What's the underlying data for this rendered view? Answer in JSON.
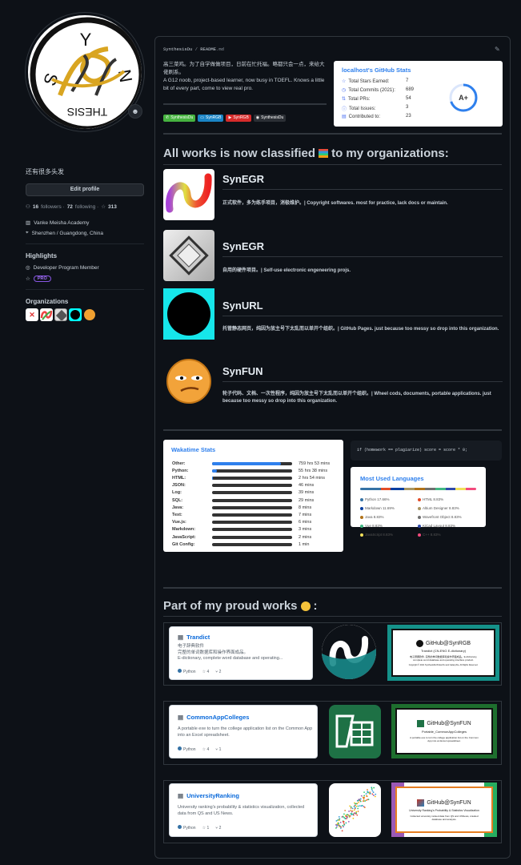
{
  "profile": {
    "bio": "还有很多头发",
    "edit_profile": "Edit profile",
    "followers_count": "16",
    "followers_label": "followers ·",
    "following_count": "72",
    "following_label": "following ·",
    "stars_count": "313",
    "organization": "Vanke Meisha Academy",
    "location": "Shenzhen / Guangdong, China",
    "avatar_letters": [
      "Y",
      "S",
      "N",
      "THESIS"
    ]
  },
  "highlights": {
    "title": "Highlights",
    "program": "Developer Program Member",
    "pro": "PRO"
  },
  "organizations": {
    "title": "Organizations"
  },
  "readme": {
    "user": "SynthesisDu",
    "sep": " / ",
    "file": "README",
    "ext": ".md",
    "intro_cn": "高三菜鸡。为了自学做做项目，日前在忙托福。略都只会一点，来给大佬刷系。",
    "intro_en": "A G12 noob, project-based learner, now busy in TOEFL. Knows a little bit of every part, come to view real pro.",
    "badges": [
      {
        "label": "SynthesisDu",
        "color": "#46b340"
      },
      {
        "label": "SynRGB",
        "color": "#1a84c5"
      },
      {
        "label": "SynRGB",
        "color": "#d62b2b"
      },
      {
        "label": "SynthesisDu",
        "color": "#2b2f35"
      }
    ]
  },
  "gh_stats": {
    "title": "localhost's GitHub Stats",
    "rows": [
      {
        "label": "Total Stars Earned:",
        "value": "7",
        "icon": "☆"
      },
      {
        "label": "Total Commits (2021):",
        "value": "689",
        "icon": "◷"
      },
      {
        "label": "Total PRs:",
        "value": "54",
        "icon": "⇅"
      },
      {
        "label": "Total Issues:",
        "value": "3",
        "icon": "ⓘ"
      },
      {
        "label": "Contributed to:",
        "value": "23",
        "icon": "▤"
      }
    ],
    "grade": "A+",
    "grade_progress": 0.7
  },
  "works_heading": "All works is now classified",
  "works_heading_suffix": "to my organizations:",
  "orgs": [
    {
      "name": "SynEGR",
      "desc": "正式软件，多为练手项目，消极维护。| Copyright softwares. most for practice, lack docs or maintain."
    },
    {
      "name": "SynEGR",
      "desc": "自用的硬件项目。| Self-use electronic engeneering projs."
    },
    {
      "name": "SynURL",
      "desc": "托管静态网页，纯因为放主号下太乱而以单开个组织。| GitHub Pages. just because too messy so drop into this organization."
    },
    {
      "name": "SynFUN",
      "desc": "轮子代码、文档、一次性程序，纯因为放主号下太乱而以单开个组织。| Wheel cods, documents, portable applications. just because too messy so drop into this organization."
    }
  ],
  "wakatime": {
    "title": "Wakatime Stats",
    "rows": [
      {
        "lang": "Other:",
        "time": "759 hrs 53 mins",
        "pct": 0.86
      },
      {
        "lang": "Python:",
        "time": "55 hrs 38 mins",
        "pct": 0.063
      },
      {
        "lang": "HTML:",
        "time": "2 hrs 54 mins",
        "pct": 0.01
      },
      {
        "lang": "JSON:",
        "time": "46 mins",
        "pct": 0
      },
      {
        "lang": "Log:",
        "time": "39 mins",
        "pct": 0
      },
      {
        "lang": "SQL:",
        "time": "29 mins",
        "pct": 0
      },
      {
        "lang": "Java:",
        "time": "8 mins",
        "pct": 0
      },
      {
        "lang": "Text:",
        "time": "7 mins",
        "pct": 0
      },
      {
        "lang": "Vue.js:",
        "time": "6 mins",
        "pct": 0
      },
      {
        "lang": "Markdown:",
        "time": "3 mins",
        "pct": 0
      },
      {
        "lang": "JavaScript:",
        "time": "2 mins",
        "pct": 0
      },
      {
        "lang": "Git Config:",
        "time": "1 min",
        "pct": 0
      }
    ]
  },
  "code_snippet": "if (homework == plagiarize) score = score * 0;",
  "languages": {
    "title": "Most Used Languages",
    "items": [
      {
        "name": "Python 17.66%",
        "color": "#3572a5",
        "pct": 17.66
      },
      {
        "name": "HTML 8.83%",
        "color": "#e34c26",
        "pct": 8.83
      },
      {
        "name": "Markdown 11.69%",
        "color": "#083fa1",
        "pct": 11.69
      },
      {
        "name": "Altium Designer 8.83%",
        "color": "#a89663",
        "pct": 8.83
      },
      {
        "name": "Java 8.83%",
        "color": "#b07219",
        "pct": 8.83
      },
      {
        "name": "Wavefront Object 8.83%",
        "color": "#6f6f6f",
        "pct": 8.83
      },
      {
        "name": "Vue 8.83%",
        "color": "#41b883",
        "pct": 8.83
      },
      {
        "name": "KiCad Layout 8.83%",
        "color": "#2f4aab",
        "pct": 8.83
      },
      {
        "name": "JavaScript 8.83%",
        "color": "#f1e05a",
        "pct": 8.83
      },
      {
        "name": "C++ 8.83%",
        "color": "#f34b7d",
        "pct": 8.83
      }
    ]
  },
  "proud_heading": "Part of my proud works",
  "projects": [
    {
      "name": "Trandict",
      "desc_cn": "电子辞典软件",
      "desc_cn2": "完整的单词数据库和操作界面成品。",
      "desc": "E-dictionary, complete word database and operating...",
      "lang": "Python",
      "stars": "4",
      "forks": "2",
      "banner_title": "GitHub@SynRGB",
      "banner_sub": "Trandict (CN-ENG E-dictionary)",
      "banner_text": "电子辞典软件, 完整的单词数据库和操作界面成品。E-dictionary, complete word database and operating interface product.",
      "banner_copy": "Copyright © 2021 SynthesisDu/Xinkai Du and GalaxyXie, All Rights Reserved."
    },
    {
      "name": "CommonAppColleges",
      "desc": "A portable exe to turn the college application list on the Common App into an Excel spreadsheet.",
      "lang": "Python",
      "stars": "4",
      "forks": "1",
      "banner_title": "GitHub@SynFUN",
      "banner_sub": "Portable_CommonAppColleges",
      "banner_text": "A portable exe to turn the college application list on the Common App into an Excel spreadsheet."
    },
    {
      "name": "UniversityRanking",
      "desc": "University ranking's probability & statistics visualization, collected data from QS and US News.",
      "lang": "Python",
      "stars": "1",
      "forks": "2",
      "banner_title": "GitHub@SynFUN",
      "banner_sub": "University Ranking's Probability & Statistics Visualization",
      "banner_text": "Collected university ranked data from QS and USNews, crawled database and analysis."
    }
  ]
}
